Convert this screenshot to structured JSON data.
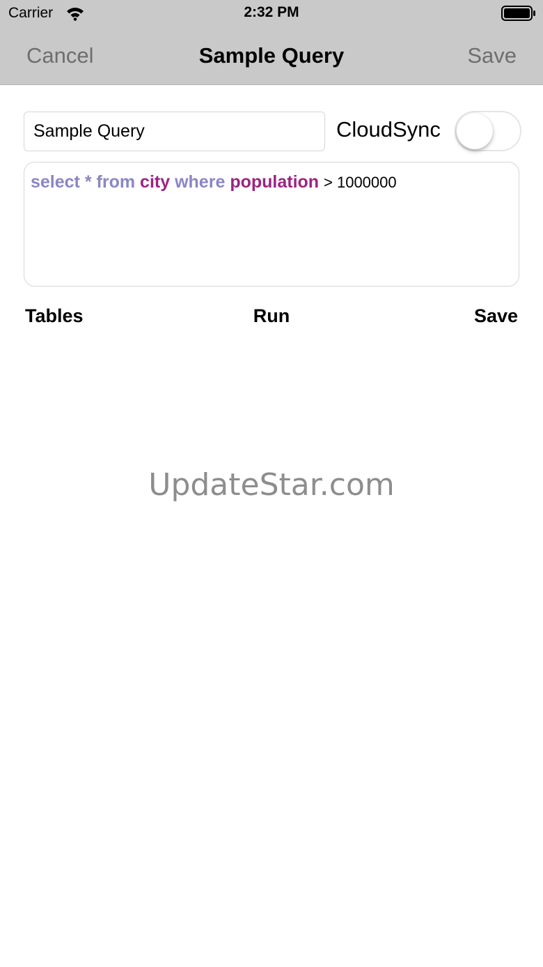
{
  "status_bar": {
    "carrier": "Carrier",
    "time": "2:32 PM",
    "icons": [
      "wifi-icon",
      "battery-icon"
    ]
  },
  "nav": {
    "cancel_label": "Cancel",
    "title": "Sample Query",
    "save_label": "Save"
  },
  "form": {
    "query_name_value": "Sample Query",
    "cloudsync_label": "CloudSync",
    "cloudsync_on": false
  },
  "query": {
    "tokens": [
      {
        "text": "select",
        "kind": "keyword"
      },
      {
        "text": "*",
        "kind": "keyword"
      },
      {
        "text": "from",
        "kind": "keyword"
      },
      {
        "text": "city",
        "kind": "identifier"
      },
      {
        "text": "where",
        "kind": "keyword"
      },
      {
        "text": "population",
        "kind": "identifier"
      },
      {
        "text": "> 1000000",
        "kind": "plain"
      }
    ]
  },
  "actions": {
    "tables_label": "Tables",
    "run_label": "Run",
    "save_label": "Save"
  },
  "watermark": "UpdateStar.com",
  "colors": {
    "bar_background": "#c9c9c9",
    "keyword": "#8a86c4",
    "identifier": "#9b2484",
    "nav_button": "#6e6e6e",
    "watermark": "#8d8d8d"
  }
}
